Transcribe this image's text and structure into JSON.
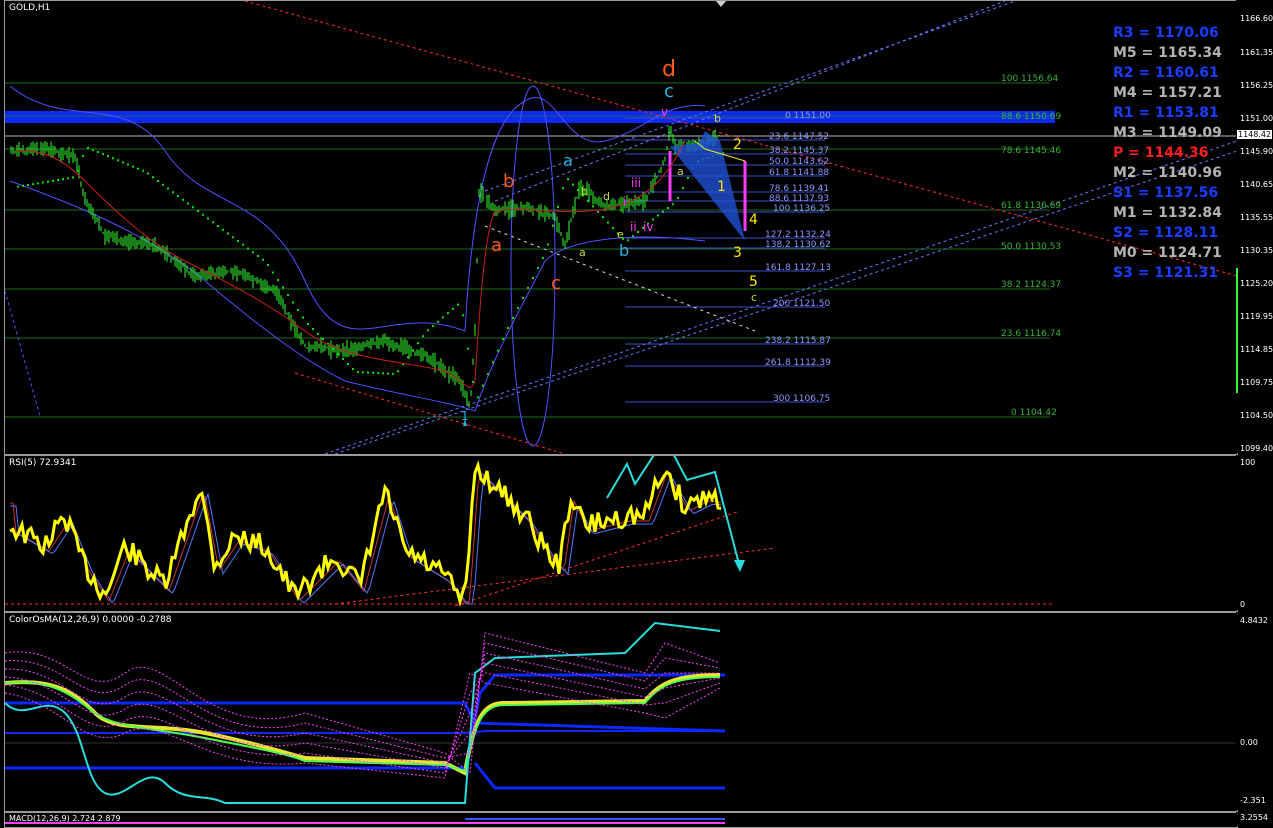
{
  "window": {
    "title": "GOLD,H1"
  },
  "main_chart": {
    "y_axis_ticks": [
      "1166.60",
      "1161.35",
      "1156.25",
      "1151.00",
      "1145.90",
      "1140.65",
      "1135.55",
      "1130.35",
      "1125.20",
      "1119.95",
      "1114.85",
      "1109.75",
      "1104.50",
      "1099.40"
    ],
    "current_price": "1148.42",
    "pivots": [
      {
        "label": "R3 = 1170.06",
        "color": "#1a3cff"
      },
      {
        "label": "M5 = 1165.34",
        "color": "#b4b4b4"
      },
      {
        "label": "R2 = 1160.61",
        "color": "#1a3cff"
      },
      {
        "label": "M4 = 1157.21",
        "color": "#b4b4b4"
      },
      {
        "label": "R1 = 1153.81",
        "color": "#1a3cff"
      },
      {
        "label": "M3 = 1149.09",
        "color": "#b4b4b4"
      },
      {
        "label": "P  = 1144.36",
        "color": "#ff1e1e"
      },
      {
        "label": "M2 = 1140.96",
        "color": "#b4b4b4"
      },
      {
        "label": "S1 = 1137.56",
        "color": "#1a3cff"
      },
      {
        "label": "M1 = 1132.84",
        "color": "#b4b4b4"
      },
      {
        "label": "S2 = 1128.11",
        "color": "#1a3cff"
      },
      {
        "label": "M0 = 1124.71",
        "color": "#b4b4b4"
      },
      {
        "label": "S3 = 1121.31",
        "color": "#1a3cff"
      }
    ],
    "fib_retracement_green": [
      "100 1156.64",
      "88.6 1150.69",
      "78.6 1145.46",
      "61.8 1136.69",
      "50.0 1130.53",
      "38.2 1124.37",
      "23.6 1116.74",
      "0 1104.42"
    ],
    "fib_expansion_blue": [
      "0 1151.00",
      "23.6 1147.52",
      "38.2 1145.37",
      "50.0 1143.62",
      "61.8 1141.88",
      "78.6 1139.41",
      "88.6 1137.93",
      "100 1136.25",
      "127.2 1132.24",
      "138.2 1130.62",
      "161.8 1127.13",
      "200 1121.50",
      "238.2 1115.87",
      "261.8 1112.39",
      "300 1106.75"
    ],
    "wave_labels": [
      {
        "text": "d",
        "color": "#ff5a1a"
      },
      {
        "text": "c",
        "color": "#28b4e6"
      },
      {
        "text": "b",
        "color": "#ff5a1a"
      },
      {
        "text": "a",
        "color": "#ff5a1a"
      },
      {
        "text": "c",
        "color": "#ff5a1a"
      },
      {
        "text": "a",
        "color": "#28b4e6"
      },
      {
        "text": "b",
        "color": "#28b4e6"
      },
      {
        "text": "1",
        "color": "#ffe600"
      },
      {
        "text": "2",
        "color": "#ffe600"
      },
      {
        "text": "3",
        "color": "#ffe600"
      },
      {
        "text": "4",
        "color": "#ffe600"
      },
      {
        "text": "5",
        "color": "#ffe600"
      },
      {
        "text": "c",
        "color": "#c8dc32"
      },
      {
        "text": "b",
        "color": "#c8dc32"
      },
      {
        "text": "d",
        "color": "#c8dc32"
      },
      {
        "text": "a",
        "color": "#c8dc32"
      },
      {
        "text": "e",
        "color": "#c8dc32"
      },
      {
        "text": "iii",
        "color": "#ff3cff"
      },
      {
        "text": "ii",
        "color": "#ff3cff"
      },
      {
        "text": "i",
        "color": "#ff3cff"
      },
      {
        "text": "v",
        "color": "#ff3cff"
      },
      {
        "text": "iv",
        "color": "#ff3cff"
      },
      {
        "text": "b",
        "color": "#c8dc32"
      },
      {
        "text": "a",
        "color": "#c8dc32"
      },
      {
        "text": "1",
        "color": "#28b4e6"
      }
    ]
  },
  "rsi_panel": {
    "title": "RSI(5) 72.9341",
    "axis_max": "100",
    "axis_min": "0"
  },
  "osma_panel": {
    "title": "ColorOsMA(12,26,9) 0.0000 -0.2788",
    "axis_top": "4.8432",
    "axis_mid": "0.00",
    "axis_bottom": "-2.351"
  },
  "macd_panel": {
    "title": "MACD(12,26,9) 2.724 2.879",
    "axis_label": "3.2554"
  },
  "colors": {
    "candles": "#32ff32",
    "bollinger": "#5050ff",
    "psar": "#00e600",
    "rsi": "#ffff00",
    "pivot_band": "#0a28ff"
  }
}
